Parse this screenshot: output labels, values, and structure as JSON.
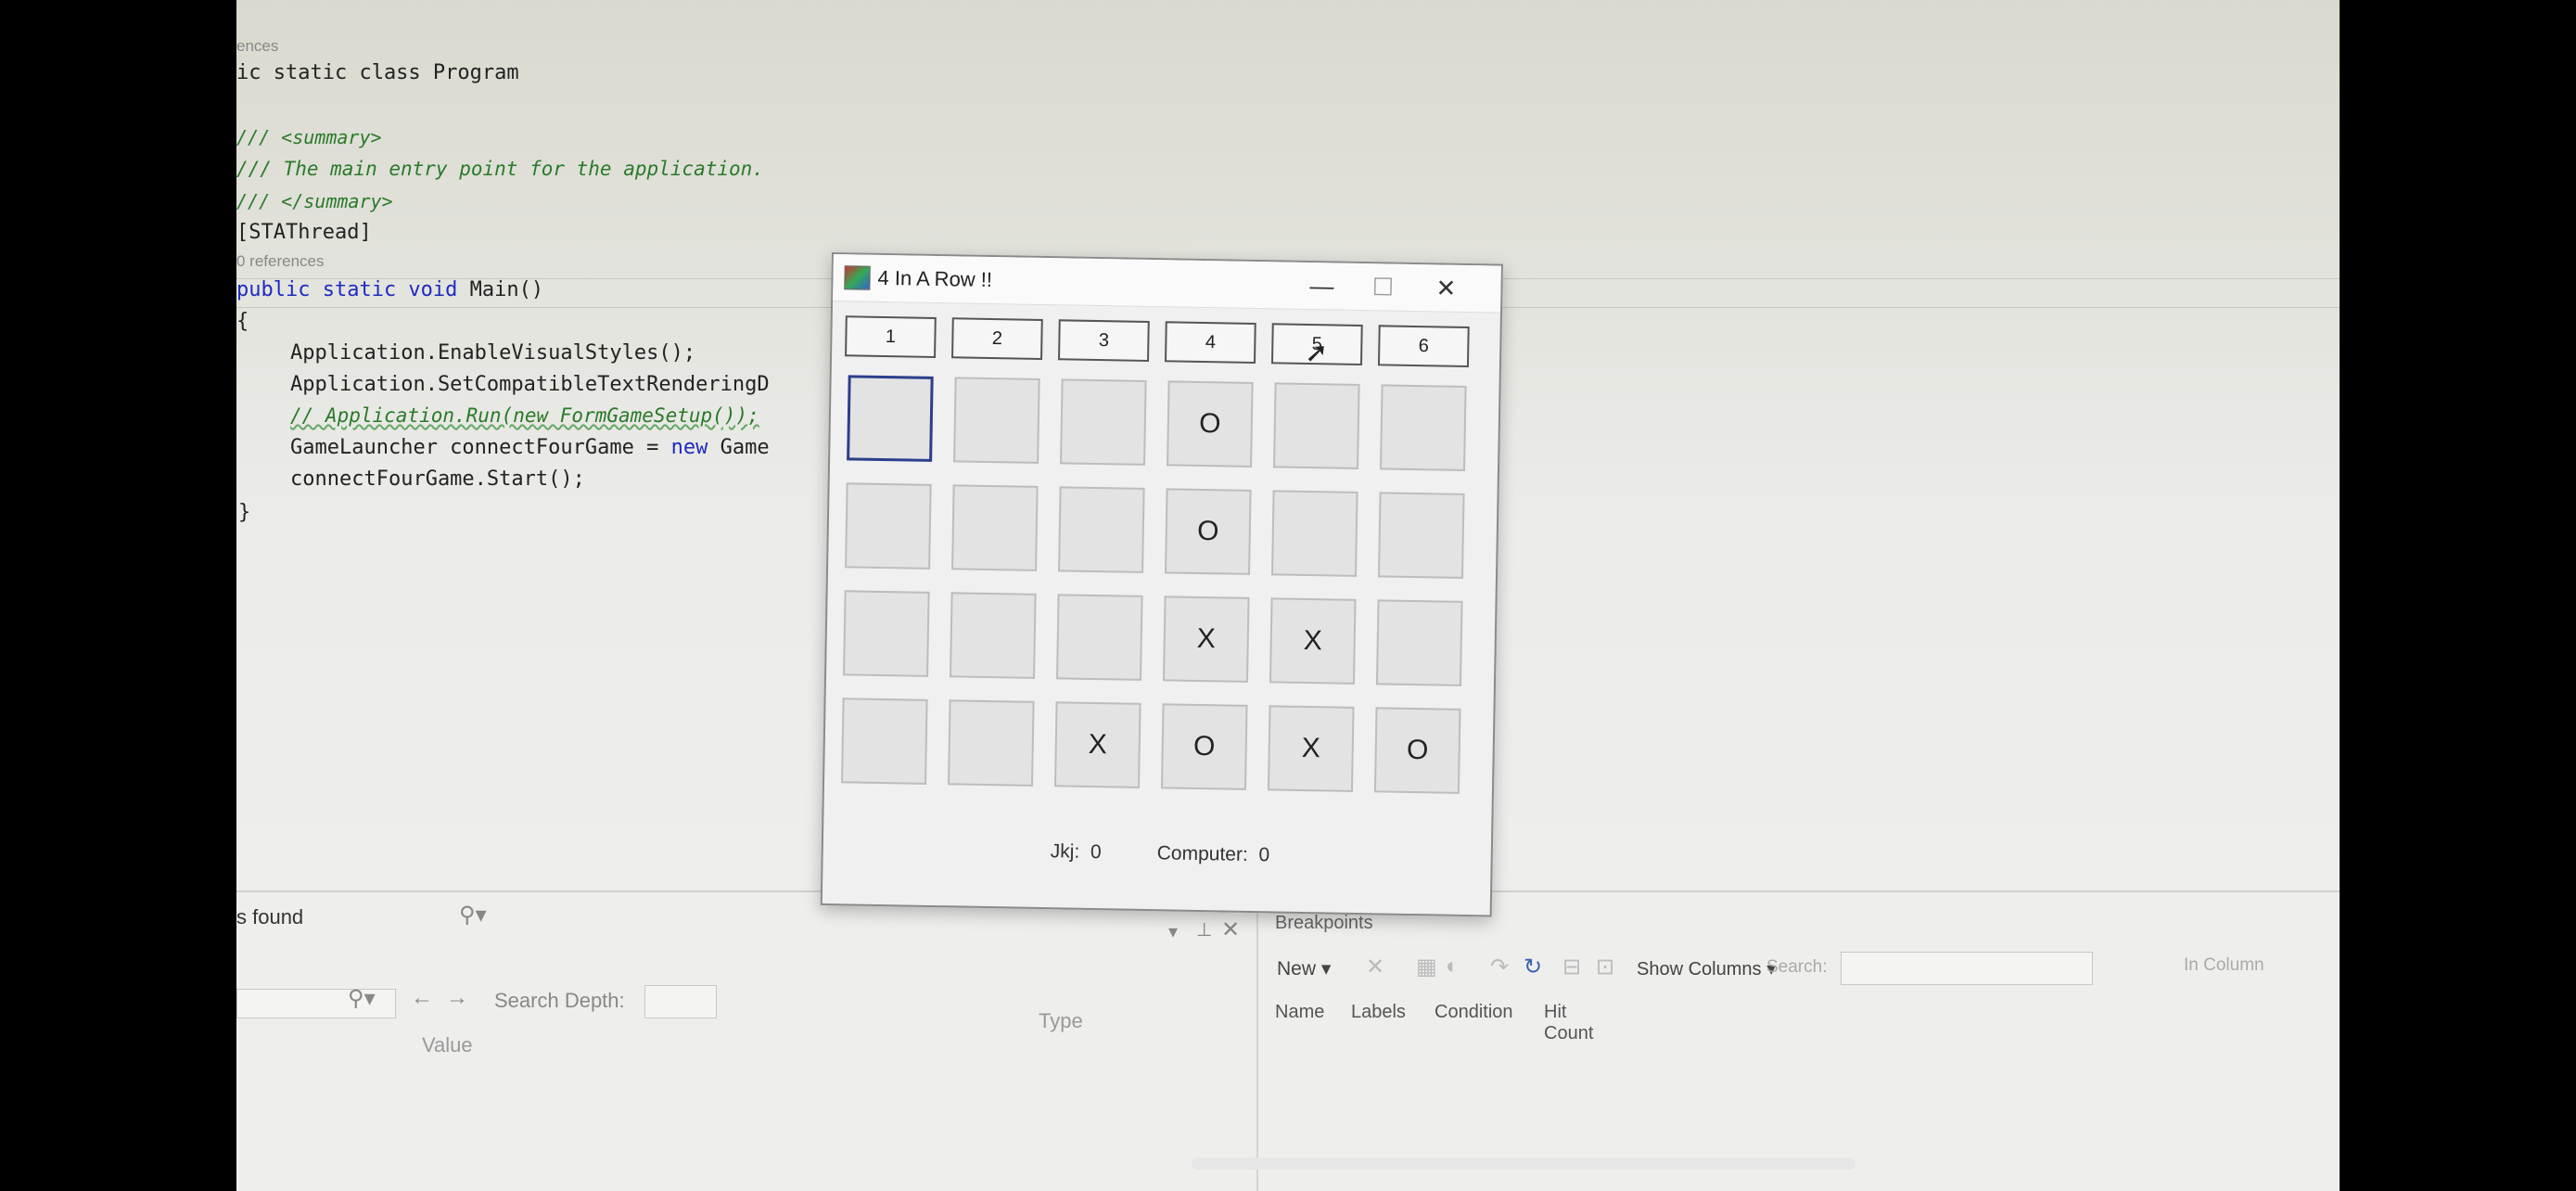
{
  "editor": {
    "ref_top": "ences",
    "class_decl": "ic static class Program",
    "summary_open": "/// <summary>",
    "summary_text": "/// The main entry point for the application.",
    "summary_close": "/// </summary>",
    "attribute": "[STAThread]",
    "references": "0 references",
    "main_kw": "public static void",
    "main_name": " Main()",
    "brace_open": "{",
    "line1": "Application.EnableVisualStyles();",
    "line2": "Application.SetCompatibleTextRenderingD",
    "line3": "// Application.Run(new FormGameSetup());",
    "line4_a": "GameLauncher connectFourGame = ",
    "line4_kw": "new",
    "line4_b": " Game",
    "line5": "connectFourGame.Start();",
    "brace_close": "}"
  },
  "game_window": {
    "title": "4 In A Row !!",
    "minimize": "—",
    "maximize": "☐",
    "close": "✕",
    "column_buttons": [
      "1",
      "2",
      "3",
      "4",
      "5",
      "6"
    ],
    "board": [
      [
        "",
        "",
        "",
        "O",
        "",
        ""
      ],
      [
        "",
        "",
        "",
        "O",
        "",
        ""
      ],
      [
        "",
        "",
        "",
        "X",
        "X",
        ""
      ],
      [
        "",
        "",
        "X",
        "O",
        "X",
        "O"
      ]
    ],
    "player_label": "Jkj:",
    "player_score": "0",
    "computer_label": "Computer:",
    "computer_score": "0"
  },
  "bottom_panel": {
    "found_text": "s found",
    "search_depth_label": "Search Depth:",
    "value_col": "Value",
    "type_col": "Type",
    "breakpoints_title": "Breakpoints",
    "new_label": "New",
    "show_columns": "Show Columns",
    "search_label": "Search:",
    "in_column": "In Column",
    "columns": [
      "Name",
      "Labels",
      "Condition",
      "Hit Count"
    ]
  }
}
